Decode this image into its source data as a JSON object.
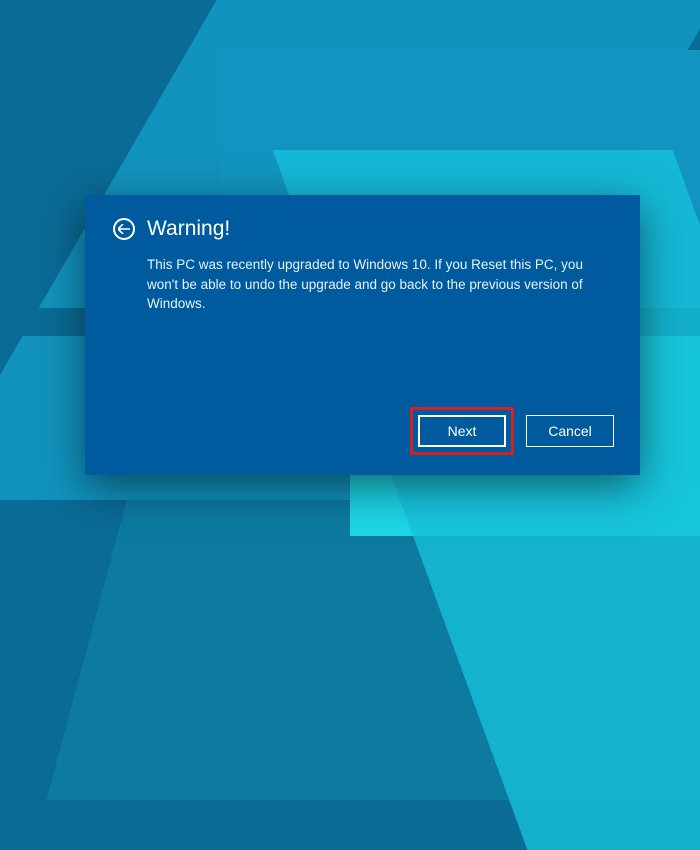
{
  "dialog": {
    "title": "Warning!",
    "message": "This PC was recently upgraded to Windows 10. If you Reset this PC, you won't be able to undo the upgrade and go back to the previous version of Windows.",
    "next_label": "Next",
    "cancel_label": "Cancel"
  },
  "colors": {
    "dialog_bg": "#005a9e",
    "highlight": "#d22222"
  }
}
